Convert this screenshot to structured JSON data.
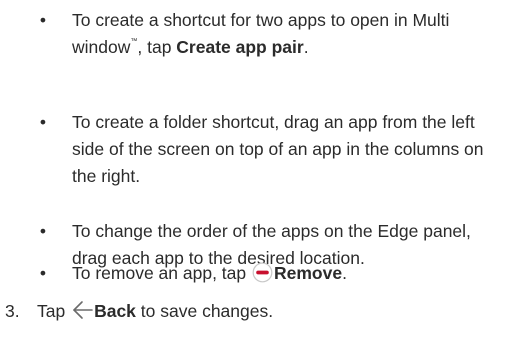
{
  "bullets": {
    "dot": "•",
    "app_pair": {
      "text_before": "To create a shortcut for two apps to open in Multi window",
      "trademark": "™",
      "text_middle": ", tap ",
      "action": "Create app pair",
      "text_after": "."
    },
    "folder": {
      "text": "To create a folder shortcut, drag an app from the left side of the screen on top of an app in the columns on the right."
    },
    "order": {
      "text": "To change the order of the apps on the Edge panel, drag each app to the desired location."
    },
    "remove": {
      "text_before": "To remove an app, tap ",
      "icon": "minus-circle-icon",
      "action": "Remove",
      "text_after": "."
    }
  },
  "step3": {
    "number": "3.",
    "text_before": "Tap ",
    "icon": "back-arrow-icon",
    "action": "Back",
    "text_after": " to save changes."
  },
  "colors": {
    "text": "#2b2b2b",
    "remove_icon": "#c8102e",
    "back_icon": "#6b6b6b"
  }
}
